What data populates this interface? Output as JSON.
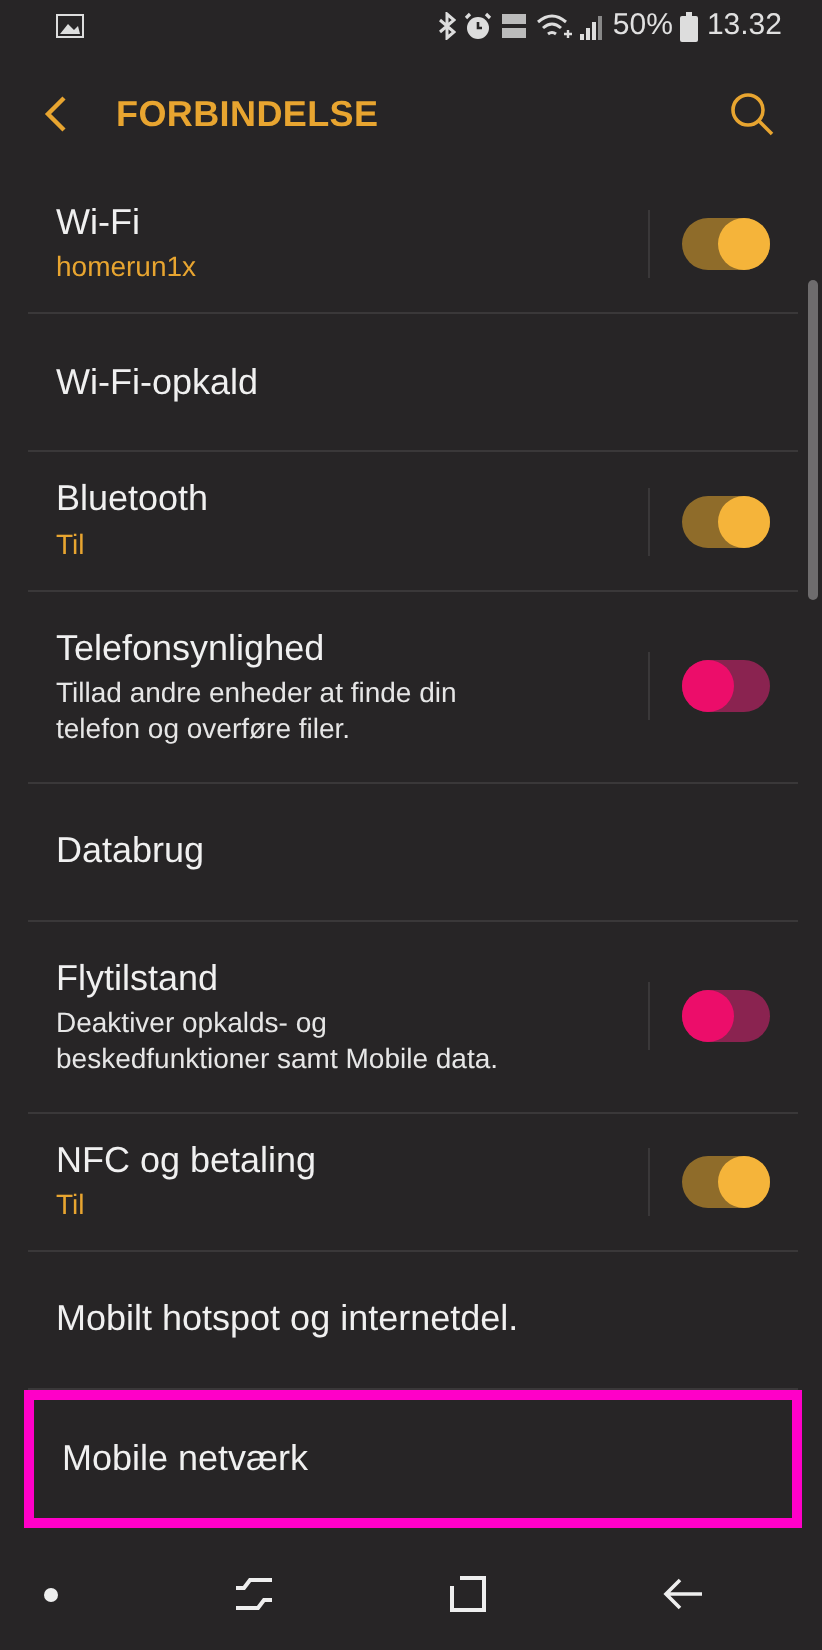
{
  "status_bar": {
    "battery": "50%",
    "time": "13.32"
  },
  "header": {
    "title": "FORBINDELSE"
  },
  "settings": [
    {
      "kind": "toggle",
      "title": "Wi-Fi",
      "status": "homerun1x",
      "on": true,
      "highlighted": false
    },
    {
      "kind": "plain",
      "title": "Wi-Fi-opkald",
      "highlighted": false
    },
    {
      "kind": "toggle",
      "title": "Bluetooth",
      "status": "Til",
      "on": true,
      "highlighted": false
    },
    {
      "kind": "toggle",
      "title": "Telefonsynlighed",
      "description": "Tillad andre enheder at finde din telefon og overføre filer.",
      "on": false,
      "highlighted": false
    },
    {
      "kind": "plain",
      "title": "Databrug",
      "highlighted": false
    },
    {
      "kind": "toggle",
      "title": "Flytilstand",
      "description": "Deaktiver opkalds- og beskedfunktioner samt Mobile data.",
      "on": false,
      "highlighted": false
    },
    {
      "kind": "toggle",
      "title": "NFC og betaling",
      "status": "Til",
      "on": true,
      "highlighted": false
    },
    {
      "kind": "plain",
      "title": "Mobilt hotspot og internetdel.",
      "highlighted": false
    },
    {
      "kind": "plain",
      "title": "Mobile netværk",
      "highlighted": true
    }
  ]
}
